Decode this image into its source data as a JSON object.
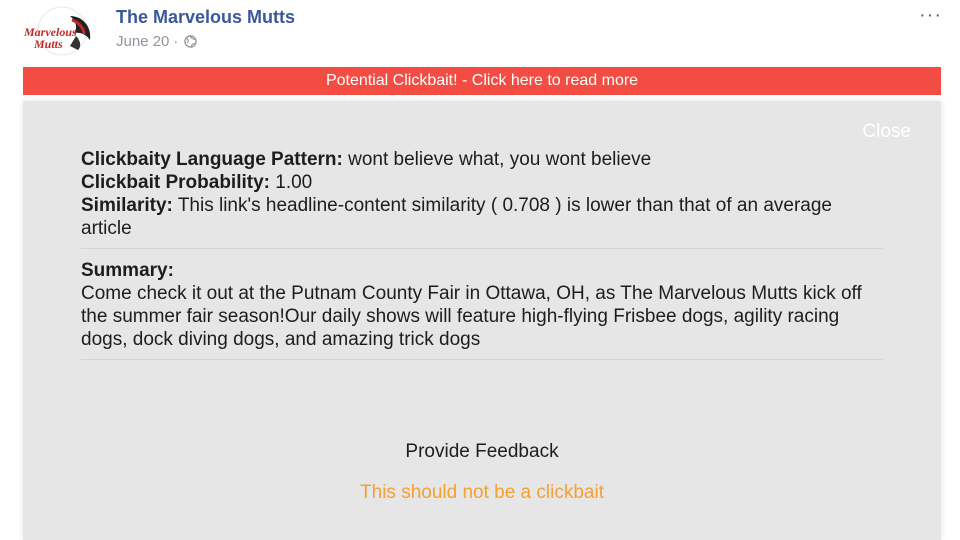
{
  "post": {
    "avatar_text": "Marvelous Mutts",
    "page_name": "The Marvelous Mutts",
    "date": "June 20",
    "separator": "·",
    "privacy_icon": "globe-icon",
    "more_label": "···"
  },
  "banner": {
    "text": "Potential Clickbait! - Click here to read more",
    "color": "#f34c42"
  },
  "panel": {
    "close_label": "Close",
    "pattern_label": "Clickbaity Language Pattern:",
    "pattern_value": "wont believe what, you wont believe",
    "probability_label": "Clickbait Probability:",
    "probability_value": "1.00",
    "similarity_label": "Similarity:",
    "similarity_value": "This link's headline-content similarity ( 0.708 ) is lower than that of an average article",
    "summary_label": "Summary:",
    "summary_text": "Come check it out at the Putnam County Fair in Ottawa, OH, as The Marvelous Mutts kick off the summer fair season!Our daily shows will feature high-flying Frisbee dogs, agility racing dogs, dock diving dogs, and amazing trick dogs",
    "feedback_title": "Provide Feedback",
    "feedback_link": "This should not be a clickbait",
    "feedback_color": "#f5a033"
  }
}
